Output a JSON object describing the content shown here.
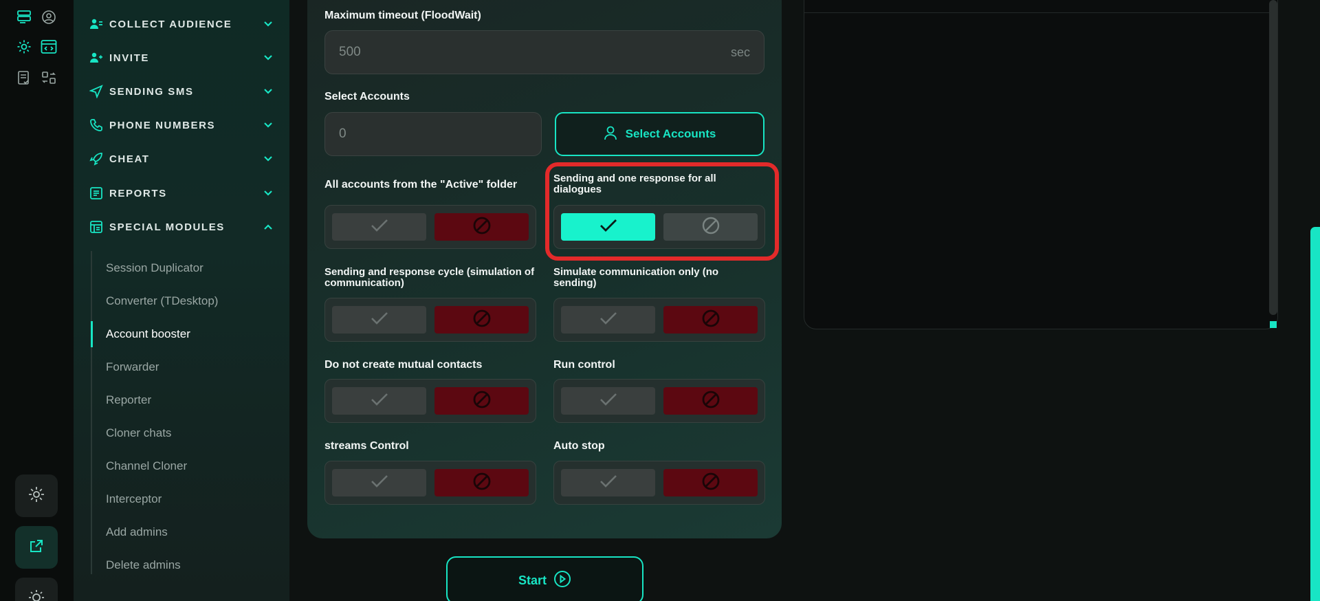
{
  "colors": {
    "accent": "#18e5c4",
    "danger": "#5c0811",
    "highlight": "#e22a2a"
  },
  "sidebar": {
    "items": [
      {
        "label": "COLLECT AUDIENCE",
        "icon": "users-icon"
      },
      {
        "label": "INVITE",
        "icon": "user-plus-icon"
      },
      {
        "label": "SENDING SMS",
        "icon": "send-icon"
      },
      {
        "label": "PHONE NUMBERS",
        "icon": "phone-icon"
      },
      {
        "label": "CHEAT",
        "icon": "rocket-icon"
      },
      {
        "label": "REPORTS",
        "icon": "report-icon"
      },
      {
        "label": "SPECIAL MODULES",
        "icon": "modules-icon"
      }
    ],
    "sub_items": [
      "Session Duplicator",
      "Converter (TDesktop)",
      "Account booster",
      "Forwarder",
      "Reporter",
      "Cloner chats",
      "Channel Cloner",
      "Interceptor",
      "Add admins",
      "Delete admins"
    ],
    "active_sub_item": "Account booster"
  },
  "form": {
    "timeout_label": "Maximum timeout (FloodWait)",
    "timeout_value": "500",
    "timeout_suffix": "sec",
    "select_label": "Select Accounts",
    "select_value": "0",
    "select_button": "Select Accounts",
    "toggles": {
      "active_folder": {
        "label": "All accounts from the \"Active\" folder",
        "state": "off"
      },
      "one_response": {
        "label": "Sending and one response for all dialogues",
        "state": "on"
      },
      "response_cycle": {
        "label": "Sending and response cycle (simulation of communication)",
        "state": "off"
      },
      "simulate_only": {
        "label": "Simulate communication only (no sending)",
        "state": "off"
      },
      "no_mutual": {
        "label": "Do not create mutual contacts",
        "state": "off"
      },
      "run_control": {
        "label": "Run control",
        "state": "off"
      },
      "streams_control": {
        "label": "streams Control",
        "state": "off"
      },
      "auto_stop": {
        "label": "Auto stop",
        "state": "off"
      }
    },
    "start_button": "Start"
  }
}
